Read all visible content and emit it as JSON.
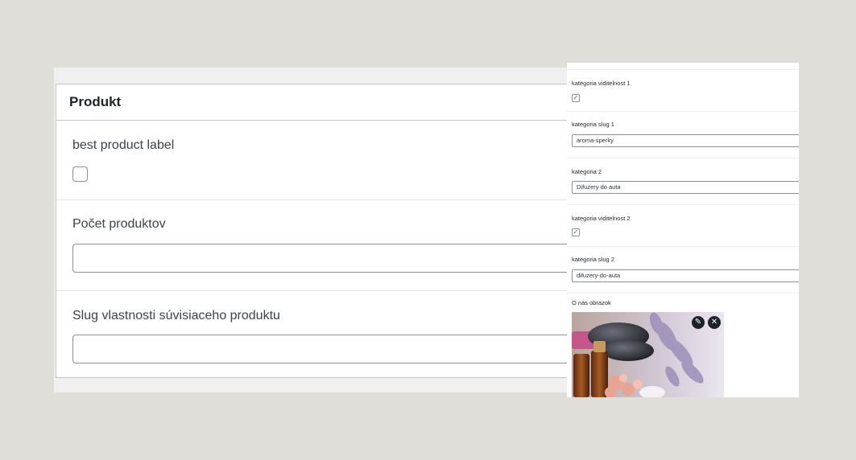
{
  "left": {
    "title": "Produkt",
    "fields": [
      {
        "label": "best product label",
        "type": "checkbox",
        "checked": false
      },
      {
        "label": "Počet produktov",
        "type": "text",
        "value": ""
      },
      {
        "label": "Slug vlastnosti súvisiaceho produktu",
        "type": "text",
        "value": ""
      }
    ]
  },
  "right": {
    "vis1_label": "kategoria viditelnost 1",
    "vis1_checked": true,
    "slug1_label": "kategoria slug 1",
    "slug1_value": "aroma-sperky",
    "cat2_label": "kategoria 2",
    "cat2_value": "Difuzery do auta",
    "vis2_label": "kategoria viditelnost 2",
    "vis2_checked": true,
    "slug2_label": "kategoria slug 2",
    "slug2_value": "difuzery-do-auta",
    "image_label": "O nás obrazok",
    "icons": {
      "edit": "pencil-icon",
      "remove": "close-icon"
    }
  },
  "colors": {
    "background": "#dfded8",
    "border": "#c3c4c7",
    "accent": "#2271b1"
  }
}
